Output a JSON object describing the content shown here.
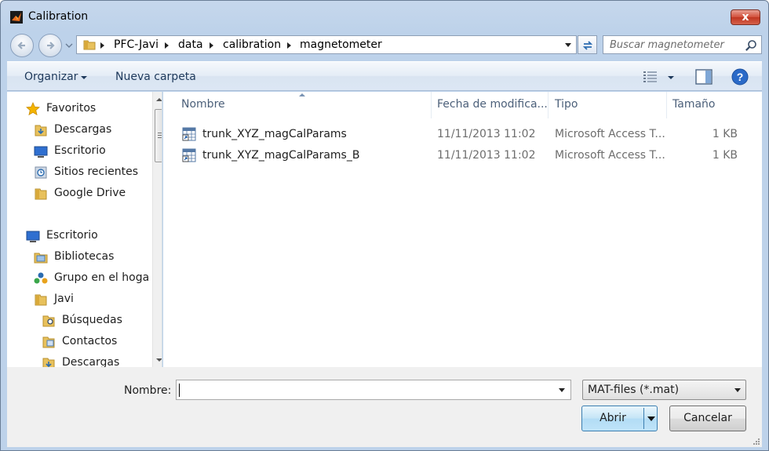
{
  "window": {
    "title": "Calibration",
    "close_label": "x"
  },
  "address": {
    "crumbs": [
      "PFC-Javi",
      "data",
      "calibration",
      "magnetometer"
    ]
  },
  "search": {
    "placeholder": "Buscar magnetometer"
  },
  "toolbar": {
    "organize_label": "Organizar",
    "new_folder_label": "Nueva carpeta"
  },
  "nav": {
    "items": [
      {
        "label": "Favoritos",
        "icon": "star-icon"
      },
      {
        "label": "Descargas",
        "icon": "downloads-folder-icon"
      },
      {
        "label": "Escritorio",
        "icon": "desktop-icon"
      },
      {
        "label": "Sitios recientes",
        "icon": "recent-places-icon"
      },
      {
        "label": "Google Drive",
        "icon": "folder-icon"
      },
      {
        "label": "Escritorio",
        "icon": "desktop-icon"
      },
      {
        "label": "Bibliotecas",
        "icon": "libraries-icon"
      },
      {
        "label": "Grupo en el hoga",
        "icon": "homegroup-icon"
      },
      {
        "label": "Javi",
        "icon": "user-folder-icon"
      },
      {
        "label": "Búsquedas",
        "icon": "searches-folder-icon"
      },
      {
        "label": "Contactos",
        "icon": "contacts-folder-icon"
      },
      {
        "label": "Descargas",
        "icon": "downloads-folder-icon"
      }
    ]
  },
  "columns": {
    "name": "Nombre",
    "date": "Fecha de modifica...",
    "type": "Tipo",
    "size": "Tamaño"
  },
  "files": [
    {
      "name": "trunk_XYZ_magCalParams",
      "date": "11/11/2013 11:02",
      "type": "Microsoft Access T...",
      "size": "1 KB"
    },
    {
      "name": "trunk_XYZ_magCalParams_B",
      "date": "11/11/2013 11:02",
      "type": "Microsoft Access T...",
      "size": "1 KB"
    }
  ],
  "footer": {
    "name_label": "Nombre:",
    "name_value": "",
    "filter_value": "MAT-files (*.mat)",
    "open_label": "Abrir",
    "cancel_label": "Cancelar"
  },
  "colors": {
    "accent": "#3c7fb1",
    "title_bar": "#bdd2ea",
    "close": "#c03521"
  }
}
